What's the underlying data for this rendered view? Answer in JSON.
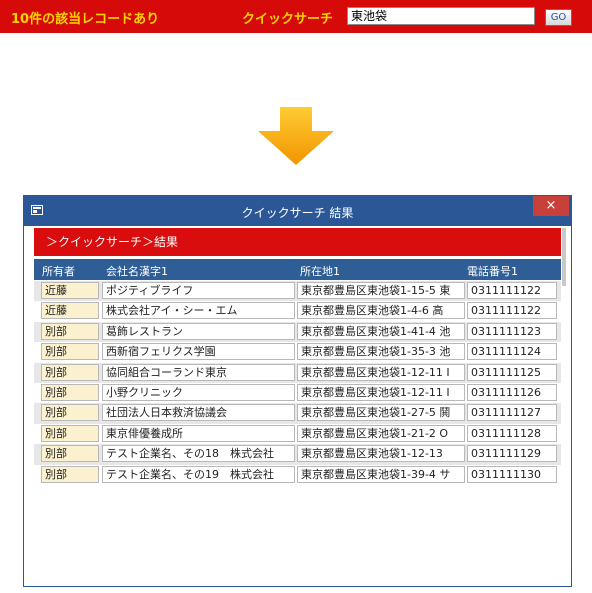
{
  "topbar": {
    "result_count": "10件の該当レコードあり",
    "quick_search_label": "クイックサーチ",
    "search_value": "東池袋",
    "go_button": "GO"
  },
  "window": {
    "title": "クイックサーチ 結果",
    "close_glyph": "×",
    "breadcrumb": "＞クイックサーチ＞結果",
    "columns": {
      "owner": "所有者",
      "company": "会社名漢字1",
      "address": "所在地1",
      "phone": "電話番号1"
    },
    "rows": [
      {
        "owner": "近藤",
        "company": "ポジティブライフ",
        "address": "東京都豊島区東池袋1-15-5 東",
        "phone": "0311111122"
      },
      {
        "owner": "近藤",
        "company": "株式会社アイ・シー・エム",
        "address": "東京都豊島区東池袋1-4-6 高",
        "phone": "0311111122"
      },
      {
        "owner": "別部",
        "company": "葛飾レストラン",
        "address": "東京都豊島区東池袋1-41-4 池",
        "phone": "0311111123"
      },
      {
        "owner": "別部",
        "company": "西新宿フェリクス学園",
        "address": "東京都豊島区東池袋1-35-3 池",
        "phone": "0311111124"
      },
      {
        "owner": "別部",
        "company": "協同組合コーランド東京",
        "address": "東京都豊島区東池袋1-12-11 I",
        "phone": "0311111125"
      },
      {
        "owner": "別部",
        "company": "小野クリニック",
        "address": "東京都豊島区東池袋1-12-11 I",
        "phone": "0311111126"
      },
      {
        "owner": "別部",
        "company": "社団法人日本救済協議会",
        "address": "東京都豊島区東池袋1-27-5 鬨",
        "phone": "0311111127"
      },
      {
        "owner": "別部",
        "company": "東京俳優養成所",
        "address": "東京都豊島区東池袋1-21-2 O",
        "phone": "0311111128"
      },
      {
        "owner": "別部",
        "company": "テスト企業名、その18　株式会社",
        "address": "東京都豊島区東池袋1-12-13 ",
        "phone": "0311111129"
      },
      {
        "owner": "別部",
        "company": "テスト企業名、その19　株式会社",
        "address": "東京都豊島区東池袋1-39-4 サ",
        "phone": "0311111130"
      }
    ]
  },
  "colors": {
    "header_red": "#d70a0a",
    "label_yellow": "#ffd400",
    "window_blue": "#2b5797",
    "arrow_orange": "#f4a300"
  }
}
